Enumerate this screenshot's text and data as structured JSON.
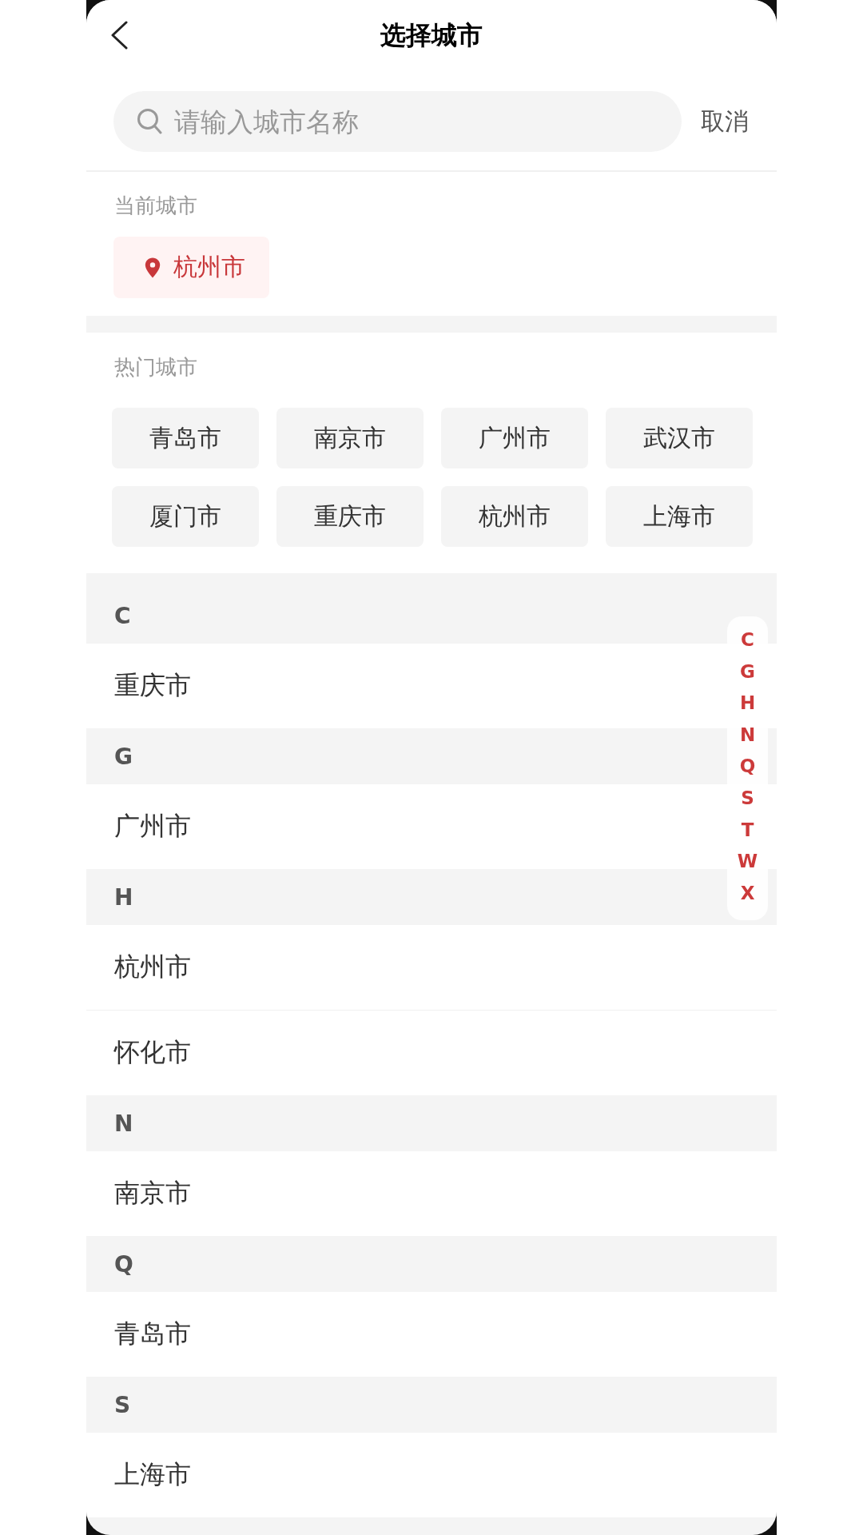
{
  "nav": {
    "title": "选择城市"
  },
  "search": {
    "placeholder": "请输入城市名称",
    "cancel": "取消"
  },
  "current_city": {
    "label": "当前城市",
    "city": "杭州市"
  },
  "hot_cities": {
    "label": "热门城市",
    "cities": [
      "青岛市",
      "南京市",
      "广州市",
      "武汉市",
      "厦门市",
      "重庆市",
      "杭州市",
      "上海市"
    ]
  },
  "sections": [
    {
      "letter": "C",
      "cities": [
        "重庆市"
      ]
    },
    {
      "letter": "G",
      "cities": [
        "广州市"
      ]
    },
    {
      "letter": "H",
      "cities": [
        "杭州市",
        "怀化市"
      ]
    },
    {
      "letter": "N",
      "cities": [
        "南京市"
      ]
    },
    {
      "letter": "Q",
      "cities": [
        "青岛市"
      ]
    },
    {
      "letter": "S",
      "cities": [
        "上海市"
      ]
    }
  ],
  "index_bar": [
    "C",
    "G",
    "H",
    "N",
    "Q",
    "S",
    "T",
    "W",
    "X"
  ]
}
